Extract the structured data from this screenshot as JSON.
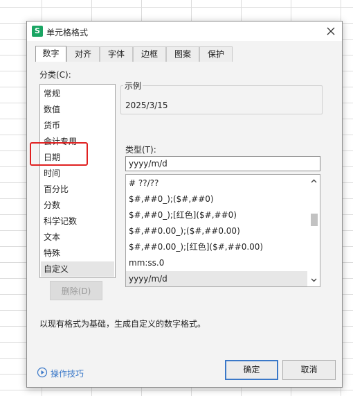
{
  "dialog": {
    "app_icon": "S",
    "title": "单元格格式",
    "close_icon": "close-icon"
  },
  "tabs": [
    {
      "label": "数字",
      "active": true
    },
    {
      "label": "对齐",
      "active": false
    },
    {
      "label": "字体",
      "active": false
    },
    {
      "label": "边框",
      "active": false
    },
    {
      "label": "图案",
      "active": false
    },
    {
      "label": "保护",
      "active": false
    }
  ],
  "category": {
    "label": "分类(C):",
    "items": [
      "常规",
      "数值",
      "货币",
      "会计专用",
      "日期",
      "时间",
      "百分比",
      "分数",
      "科学记数",
      "文本",
      "特殊",
      "自定义"
    ],
    "selected": "自定义",
    "highlighted": "日期",
    "highlight_color": "#e02020"
  },
  "example": {
    "legend": "示例",
    "value": "2025/3/15"
  },
  "type": {
    "label": "类型(T):",
    "value": "yyyy/m/d",
    "formats": [
      "# ??/??",
      "$#,##0_);($#,##0)",
      "$#,##0_);[红色]($#,##0)",
      "$#,##0.00_);($#,##0.00)",
      "$#,##0.00_);[红色]($#,##0.00)",
      "mm:ss.0",
      "yyyy/m/d"
    ],
    "selected": "yyyy/m/d"
  },
  "delete_label": "删除(D)",
  "description": "以现有格式为基础，生成自定义的数字格式。",
  "tips": {
    "label": "操作技巧",
    "icon": "play-circle-icon"
  },
  "buttons": {
    "ok": "确定",
    "cancel": "取消"
  },
  "colors": {
    "accent": "#3a78c8",
    "app_icon_bg": "#1aa563"
  }
}
